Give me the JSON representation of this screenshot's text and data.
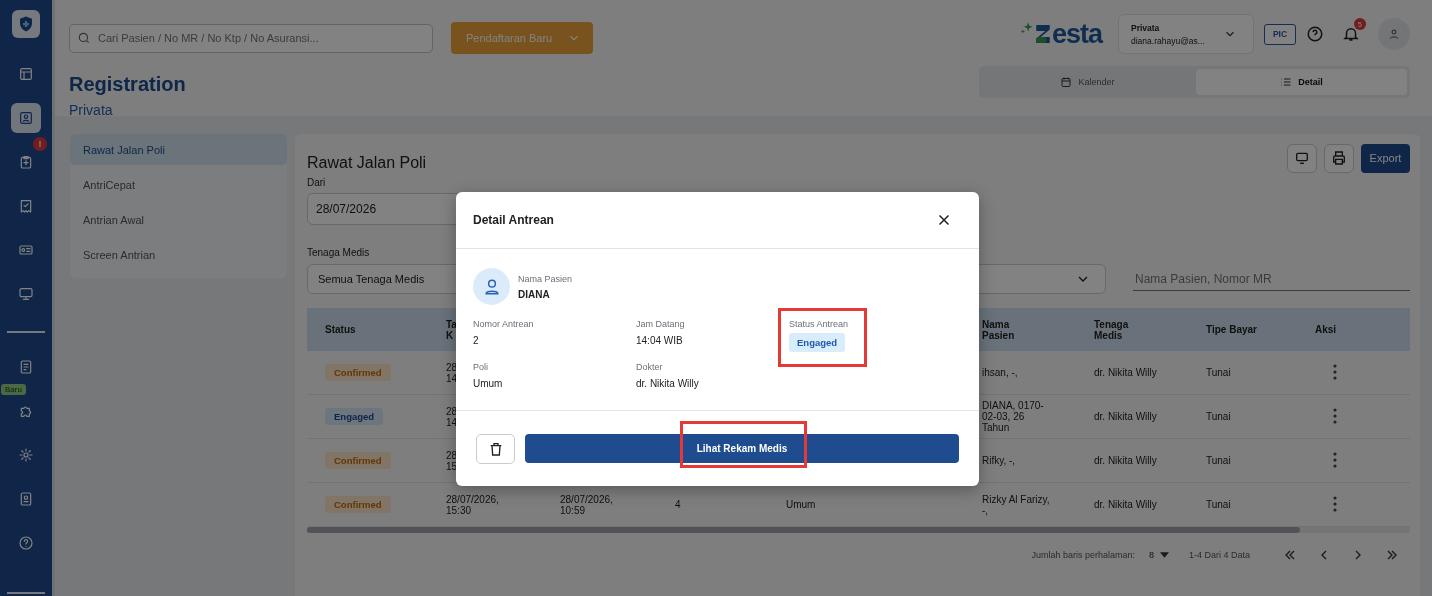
{
  "sidebar": {
    "groups": [
      [
        {
          "selected": false
        },
        {
          "selected": true
        },
        {
          "selected": false,
          "badge": {
            "kind": "alert",
            "text": "!"
          }
        },
        {
          "selected": false
        },
        {
          "selected": false
        },
        {
          "selected": false
        }
      ],
      [
        {
          "selected": false
        },
        {
          "selected": false,
          "badge": {
            "kind": "new",
            "text": "Baru"
          }
        },
        {
          "selected": false
        },
        {
          "selected": false
        },
        {
          "selected": false
        }
      ]
    ]
  },
  "header": {
    "search": {
      "placeholder": "Cari Pasien / No MR / No Ktp / No Asuransi..."
    },
    "new_button": "Pendaftaran Baru",
    "logo_text": "esta",
    "account": {
      "name": "Privata",
      "email": "diana.rahayu@as..."
    },
    "pic_button": "PIC",
    "notification_count": "5"
  },
  "page": {
    "title": "Registration",
    "subtitle": "Privata"
  },
  "view_tabs": [
    {
      "label": "Kalender",
      "selected": false
    },
    {
      "label": "Detail",
      "selected": true
    }
  ],
  "menu": [
    {
      "label": "Rawat Jalan Poli",
      "selected": true
    },
    {
      "label": "AntriCepat",
      "selected": false
    },
    {
      "label": "Antrian Awal",
      "selected": false
    },
    {
      "label": "Screen Antrian",
      "selected": false
    }
  ],
  "main": {
    "title": "Rawat Jalan Poli",
    "export_button": "Export",
    "date_label": "Dari",
    "date_value": "28/07/2026",
    "staff_label": "Tenaga Medis",
    "staff_value": "Semua Tenaga Medis",
    "search": {
      "placeholder": "Nama Pasien, Nomor MR"
    }
  },
  "table": {
    "columns": {
      "status": [
        "Status"
      ],
      "column_2": [
        "Ta",
        "K"
      ],
      "nama_pasien": [
        "Nama",
        "Pasien"
      ],
      "tenaga_medis": [
        "Tenaga",
        "Medis"
      ],
      "tipe_bayar": [
        "Tipe Bayar"
      ],
      "aksi": [
        "Aksi"
      ]
    },
    "rows": [
      {
        "status": {
          "text": "Confirmed",
          "kind": "confirmed"
        },
        "column_2": [
          "28",
          "14"
        ],
        "nama_pasien": "ihsan, -,",
        "tenaga_medis": "dr. Nikita Willy",
        "tipe_bayar": "Tunai"
      },
      {
        "status": {
          "text": "Engaged",
          "kind": "engaged"
        },
        "column_2": [
          "28",
          "14"
        ],
        "nama_pasien": "DIANA, 0170-02-03, 26 Tahun",
        "tenaga_medis": "dr. Nikita Willy",
        "tipe_bayar": "Tunai"
      },
      {
        "status": {
          "text": "Confirmed",
          "kind": "confirmed"
        },
        "column_2": [
          "28",
          "15"
        ],
        "nama_pasien": "Rifky, -,",
        "tenaga_medis": "dr. Nikita Willy",
        "tipe_bayar": "Tunai"
      },
      {
        "status": {
          "text": "Confirmed",
          "kind": "confirmed"
        },
        "column_2": [
          "28/07/2026,",
          "15:30"
        ],
        "column_3": [
          "28/07/2026,",
          "10:59"
        ],
        "column_4": "4",
        "column_5": "Umum",
        "nama_pasien": "Rizky Al Farizy, -,",
        "tenaga_medis": "dr. Nikita Willy",
        "tipe_bayar": "Tunai"
      }
    ]
  },
  "pagination": {
    "rows_label": "Jumlah baris perhalaman:",
    "rows_value": "8",
    "range": "1-4 Dari 4 Data"
  },
  "modal": {
    "title": "Detail Antrean",
    "patient_label": "Nama Pasien",
    "patient_name": "DIANA",
    "fields": [
      {
        "label": "Nomor Antrean",
        "value": "2",
        "kind": "text"
      },
      {
        "label": "Jam Datang",
        "value": "14:04 WIB",
        "kind": "text"
      },
      {
        "label": "Status Antrean",
        "value": "Engaged",
        "kind": "badge",
        "highlighted": true
      },
      {
        "label": "Poli",
        "value": "Umum",
        "kind": "text"
      },
      {
        "label": "Dokter",
        "value": "dr. Nikita Willy",
        "kind": "text"
      }
    ],
    "primary_button": {
      "label": "Lihat Rekam Medis",
      "highlighted": true
    }
  }
}
